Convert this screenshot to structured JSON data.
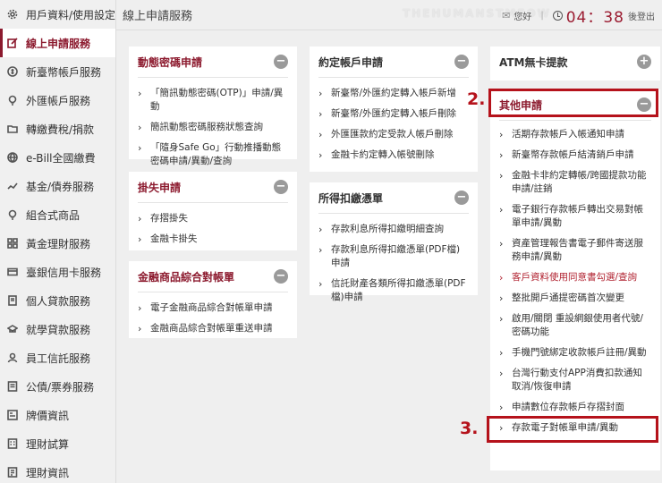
{
  "sidebar": {
    "items": [
      {
        "label": "用戶資料/使用設定",
        "icon": "gear-icon"
      },
      {
        "label": "線上申請服務",
        "icon": "edit-icon",
        "active": true
      },
      {
        "label": "新臺幣帳戶服務",
        "icon": "dollar-icon"
      },
      {
        "label": "外匯帳戶服務",
        "icon": "bulb-icon"
      },
      {
        "label": "轉繳費稅/捐款",
        "icon": "folder-icon"
      },
      {
        "label": "e-Bill全國繳費",
        "icon": "globe-icon"
      },
      {
        "label": "基金/債券服務",
        "icon": "trend-icon"
      },
      {
        "label": "組合式商品",
        "icon": "bulb-icon"
      },
      {
        "label": "黃金理財服務",
        "icon": "grid-icon"
      },
      {
        "label": "臺銀信用卡服務",
        "icon": "card-icon"
      },
      {
        "label": "個人貸款服務",
        "icon": "doc-icon"
      },
      {
        "label": "就學貸款服務",
        "icon": "cap-icon"
      },
      {
        "label": "員工信託服務",
        "icon": "person-icon"
      },
      {
        "label": "公債/票券服務",
        "icon": "ticket-icon"
      },
      {
        "label": "牌價資訊",
        "icon": "board-icon"
      },
      {
        "label": "理財試算",
        "icon": "calc-icon"
      },
      {
        "label": "理財資訊",
        "icon": "info-icon"
      }
    ]
  },
  "header": {
    "title": "線上申請服務",
    "watermark": "THEHUMANSTMEOW",
    "greeting": "您好",
    "timer": "04：38",
    "logout": "後登出"
  },
  "cards": {
    "otp": {
      "title": "動態密碼申請",
      "toggle": "−",
      "items": [
        "「簡訊動態密碼(OTP)」申請/異動",
        "簡訊動態密碼服務狀態查詢",
        "「隨身Safe Go」行動推播動態密碼申請/異動/查詢"
      ]
    },
    "lost": {
      "title": "掛失申請",
      "toggle": "−",
      "items": [
        "存摺掛失",
        "金融卡掛失"
      ]
    },
    "statement": {
      "title": "金融商品綜合對帳單",
      "toggle": "−",
      "items": [
        "電子金融商品綜合對帳單申請",
        "金融商品綜合對帳單重送申請"
      ]
    },
    "agreed": {
      "title": "約定帳戶申請",
      "toggle": "−",
      "items": [
        "新臺幣/外匯約定轉入帳戶新增",
        "新臺幣/外匯約定轉入帳戶刪除",
        "外匯匯款約定受款人帳戶刪除",
        "金融卡約定轉入帳號刪除"
      ]
    },
    "tax": {
      "title": "所得扣繳憑單",
      "toggle": "−",
      "items": [
        "存款利息所得扣繳明細查詢",
        "存款利息所得扣繳憑單(PDF檔)申請",
        "信託財產各類所得扣繳憑單(PDF檔)申請"
      ]
    },
    "atm": {
      "title": "ATM無卡提款",
      "toggle": "+"
    },
    "other": {
      "title": "其他申請",
      "toggle": "−",
      "items": [
        {
          "label": "活期存款帳戶入帳通知申請"
        },
        {
          "label": "新臺幣存款帳戶結清銷戶申請"
        },
        {
          "label": "金融卡非約定轉帳/跨國提款功能申請/註銷"
        },
        {
          "label": "電子銀行存款帳戶轉出交易對帳單申請/異動"
        },
        {
          "label": "資產管理報告書電子郵件寄送服務申請/異動"
        },
        {
          "label": "客戶資料使用同意書勾選/查詢",
          "red": true
        },
        {
          "label": "整批開戶通提密碼首次變更"
        },
        {
          "label": "啟用/關閉 重設網銀使用者代號/密碼功能"
        },
        {
          "label": "手機門號綁定收款帳戶註冊/異動"
        },
        {
          "label": "台灣行動支付APP消費扣款通知取消/恢復申請"
        },
        {
          "label": "申請數位存款帳戶存摺封面"
        },
        {
          "label": "存款電子對帳單申請/異動"
        }
      ]
    }
  },
  "annotations": {
    "step2": "2.",
    "step3": "3."
  },
  "colors": {
    "accent": "#8c1a2e",
    "highlight": "#b5121b",
    "background": "#efefef"
  }
}
